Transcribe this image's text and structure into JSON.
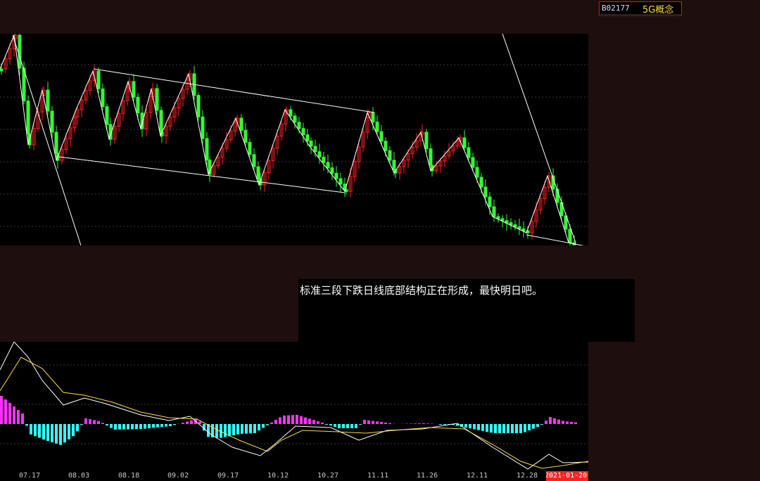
{
  "stock": {
    "code": "B02177",
    "concept": "5G概念"
  },
  "comment": "标准三段下跌日线底部结构正在形成，最快明日吧。",
  "x_axis": {
    "labels": [
      "07.17",
      "08.03",
      "08.18",
      "09.02",
      "09.17",
      "10.12",
      "10.27",
      "11.11",
      "11.26",
      "12.11",
      "12.28"
    ],
    "current_date": "2021-01-20"
  },
  "colors": {
    "up": "#ff2020",
    "down": "#33ff33",
    "trendline": "#ffffff",
    "dif": "#ffffff",
    "dea": "#ffd84a",
    "hist_pos": "#ff33ff",
    "hist_neg": "#33ffff"
  }
}
